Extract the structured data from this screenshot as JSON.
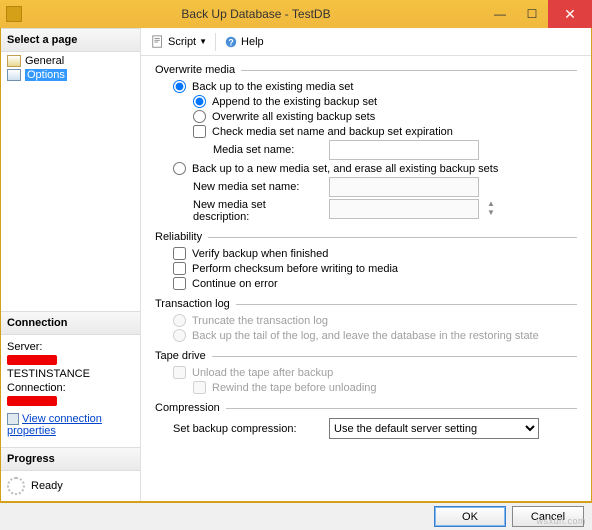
{
  "window": {
    "title": "Back Up Database - TestDB"
  },
  "pages": {
    "header": "Select a page",
    "general": "General",
    "options": "Options"
  },
  "connection": {
    "header": "Connection",
    "server_label": "Server:",
    "server_suffix": "TESTINSTANCE",
    "conn_label": "Connection:",
    "view_props": "View connection properties"
  },
  "progress": {
    "header": "Progress",
    "status": "Ready"
  },
  "toolbar": {
    "script": "Script",
    "help": "Help"
  },
  "overwrite": {
    "legend": "Overwrite media",
    "existing": "Back up to the existing media set",
    "append": "Append to the existing backup set",
    "overwrite_all": "Overwrite all existing backup sets",
    "check_media": "Check media set name and backup set expiration",
    "media_name": "Media set name:",
    "new_media": "Back up to a new media set, and erase all existing backup sets",
    "new_name": "New media set name:",
    "new_desc": "New media set description:"
  },
  "reliability": {
    "legend": "Reliability",
    "verify": "Verify backup when finished",
    "checksum": "Perform checksum before writing to media",
    "cont_err": "Continue on error"
  },
  "txlog": {
    "legend": "Transaction log",
    "truncate": "Truncate the transaction log",
    "tail": "Back up the tail of the log, and leave the database in the restoring state"
  },
  "tape": {
    "legend": "Tape drive",
    "unload": "Unload the tape after backup",
    "rewind": "Rewind the tape before unloading"
  },
  "compression": {
    "legend": "Compression",
    "label": "Set backup compression:",
    "value": "Use the default server setting"
  },
  "footer": {
    "ok": "OK",
    "cancel": "Cancel"
  },
  "watermark": "wsxdn.com"
}
